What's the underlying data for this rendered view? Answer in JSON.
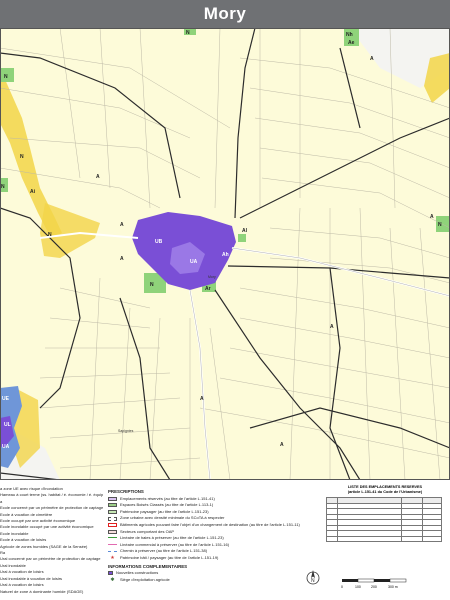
{
  "title": "Mory",
  "map": {
    "zone_labels": [
      "N",
      "N",
      "Nh",
      "Ae",
      "A",
      "N",
      "Ai",
      "N",
      "A",
      "Al",
      "N",
      "UB",
      "UA",
      "Ah",
      "N",
      "Ar",
      "A",
      "N",
      "UE",
      "UL",
      "UA",
      "A",
      "A",
      "A",
      "A",
      "A"
    ],
    "place_labels": [
      "Mory",
      "Sapignies"
    ],
    "colors": {
      "agricultural_bg": "#fdfbd9",
      "parcel_line": "#bdb9a6",
      "zone_border": "#2c2c2c",
      "flood_zone": "#f2d548",
      "natural_zone": "#8fd37a",
      "urban_purple": "#7a4fd6",
      "urban_blue": "#6f96d8",
      "outside_commune": "#f6f6f3"
    }
  },
  "legend": {
    "left_items": [
      "a zone UE avec risque d'inondation",
      "Hameau à court terme (ss. habitat / é. économie / é. équipement)",
      "a",
      "Ecole concerné par un périmètre de protection de captage",
      "Ecole à vocation de cimetière",
      "Ecole occupé par une activité économique",
      "Ecole inondable occupé par une activité économique",
      "Ecole inondable",
      "Ecole à vocation de loisirs",
      "Agricole de zones humides (SAGE de la Sensée)",
      "Ra",
      "Ural concerné par un périmètre de protection de captage",
      "Ural inondable",
      "Ural à vocation de loisirs",
      "Ural inondable à vocation de loisirs",
      "Ural à vocation de loisirs",
      "Naturel de zone à dominante humide (SDAGE)"
    ],
    "prescriptions_title": "PRESCRIPTIONS",
    "prescriptions": [
      "Emplacements réservés (au titre de l'article L.151-41)",
      "Espaces Boisés Classés (au titre de l'article L.113-1)",
      "Patrimoine paysager (au titre de l'article L.151-23)",
      "Zone urbaine avec densité minimale du SCoTA à respecter",
      "Bâtiments agricoles pouvant faire l'objet d'un changement de destination (au titre de l'article L.151-11)",
      "Secteurs comportant des OAP",
      "Linéaire de haies à préserver (au titre de l'article L.151-23)",
      "Linéaire commercial à préserver (au titre de l'article L.151-16)",
      "Chemin à préserver (au titre de l'article L.151-38)",
      "Patrimoine bâti / paysager (au titre de l'article L.151-19)"
    ],
    "info_title": "INFORMATIONS COMPLEMENTAIRES",
    "info_items": [
      "Nouvelles constructions",
      "Siège d'exploitation agricole"
    ],
    "er_title_1": "LISTE DES EMPLACEMENTS RESERVES",
    "er_title_2": "(article L.151-41 du Code de l'Urbanisme)",
    "scale_labels": [
      "0",
      "100",
      "200",
      "300 m"
    ]
  }
}
